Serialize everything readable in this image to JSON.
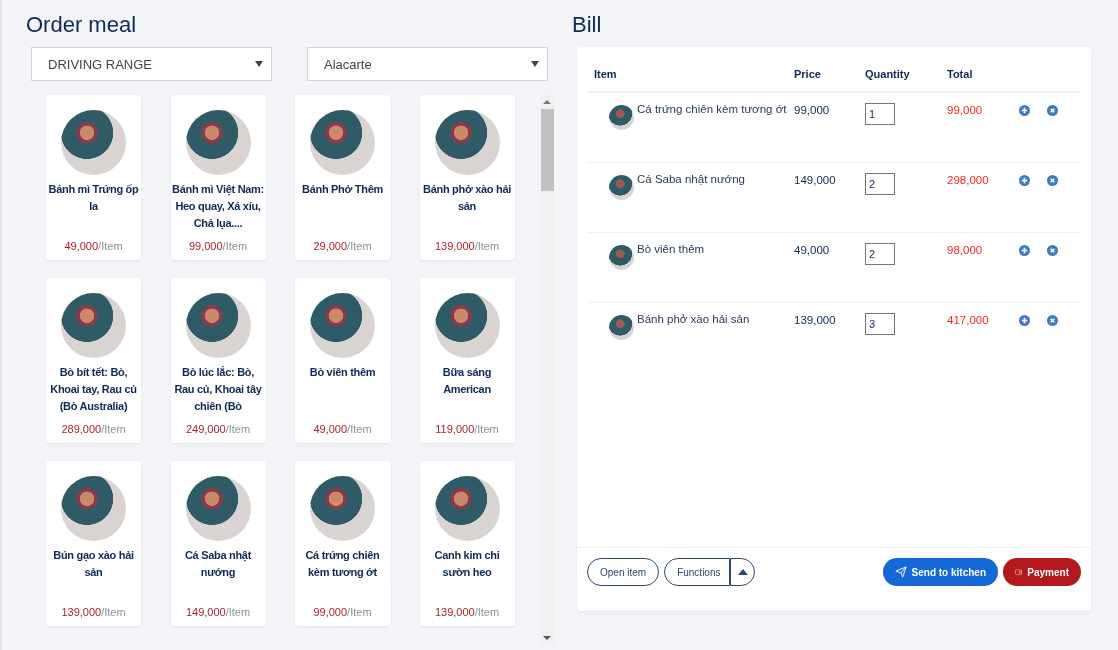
{
  "order": {
    "title": "Order meal",
    "area_select": "DRIVING RANGE",
    "menu_select": "Alacarte",
    "items": [
      {
        "name": "Bánh mì Trứng ốp la",
        "price": "49,000",
        "unit": "/Item"
      },
      {
        "name": "Bánh mì Việt Nam: Heo quay, Xá xíu, Chả lụa....",
        "price": "99,000",
        "unit": "/Item"
      },
      {
        "name": "Bánh Phở Thêm",
        "price": "29,000",
        "unit": "/Item"
      },
      {
        "name": "Bánh phở xào hải sản",
        "price": "139,000",
        "unit": "/Item"
      },
      {
        "name": "Bò bít tết: Bò, Khoai tay, Rau củ (Bò Australia)",
        "price": "289,000",
        "unit": "/Item"
      },
      {
        "name": "Bò lúc lắc: Bò, Rau củ, Khoai tây chiên (Bò",
        "price": "249,000",
        "unit": "/Item"
      },
      {
        "name": "Bò viên thêm",
        "price": "49,000",
        "unit": "/Item"
      },
      {
        "name": "Bữa sáng American",
        "price": "119,000",
        "unit": "/Item"
      },
      {
        "name": "Bún gạo xào hải sản",
        "price": "139,000",
        "unit": "/Item"
      },
      {
        "name": "Cá Saba nhật nướng",
        "price": "149,000",
        "unit": "/Item"
      },
      {
        "name": "Cá trứng chiên kèm tương ớt",
        "price": "99,000",
        "unit": "/Item"
      },
      {
        "name": "Canh kim chi sườn heo",
        "price": "139,000",
        "unit": "/Item"
      }
    ]
  },
  "bill": {
    "title": "Bill",
    "columns": [
      "Item",
      "Price",
      "Quantity",
      "Total"
    ],
    "rows": [
      {
        "item": "Cá trứng chiên kèm tương ớt",
        "price": "99,000",
        "quantity": "1",
        "total": "99,000"
      },
      {
        "item": "Cá Saba nhật nướng",
        "price": "149,000",
        "quantity": "2",
        "total": "298,000"
      },
      {
        "item": "Bò viên thêm",
        "price": "49,000",
        "quantity": "2",
        "total": "98,000"
      },
      {
        "item": "Bánh phở xào hải sản",
        "price": "139,000",
        "quantity": "3",
        "total": "417,000"
      }
    ],
    "buttons": {
      "open_item": "Open item",
      "functions": "Functions",
      "send": "Send to kitchen",
      "payment": "Payment"
    }
  }
}
